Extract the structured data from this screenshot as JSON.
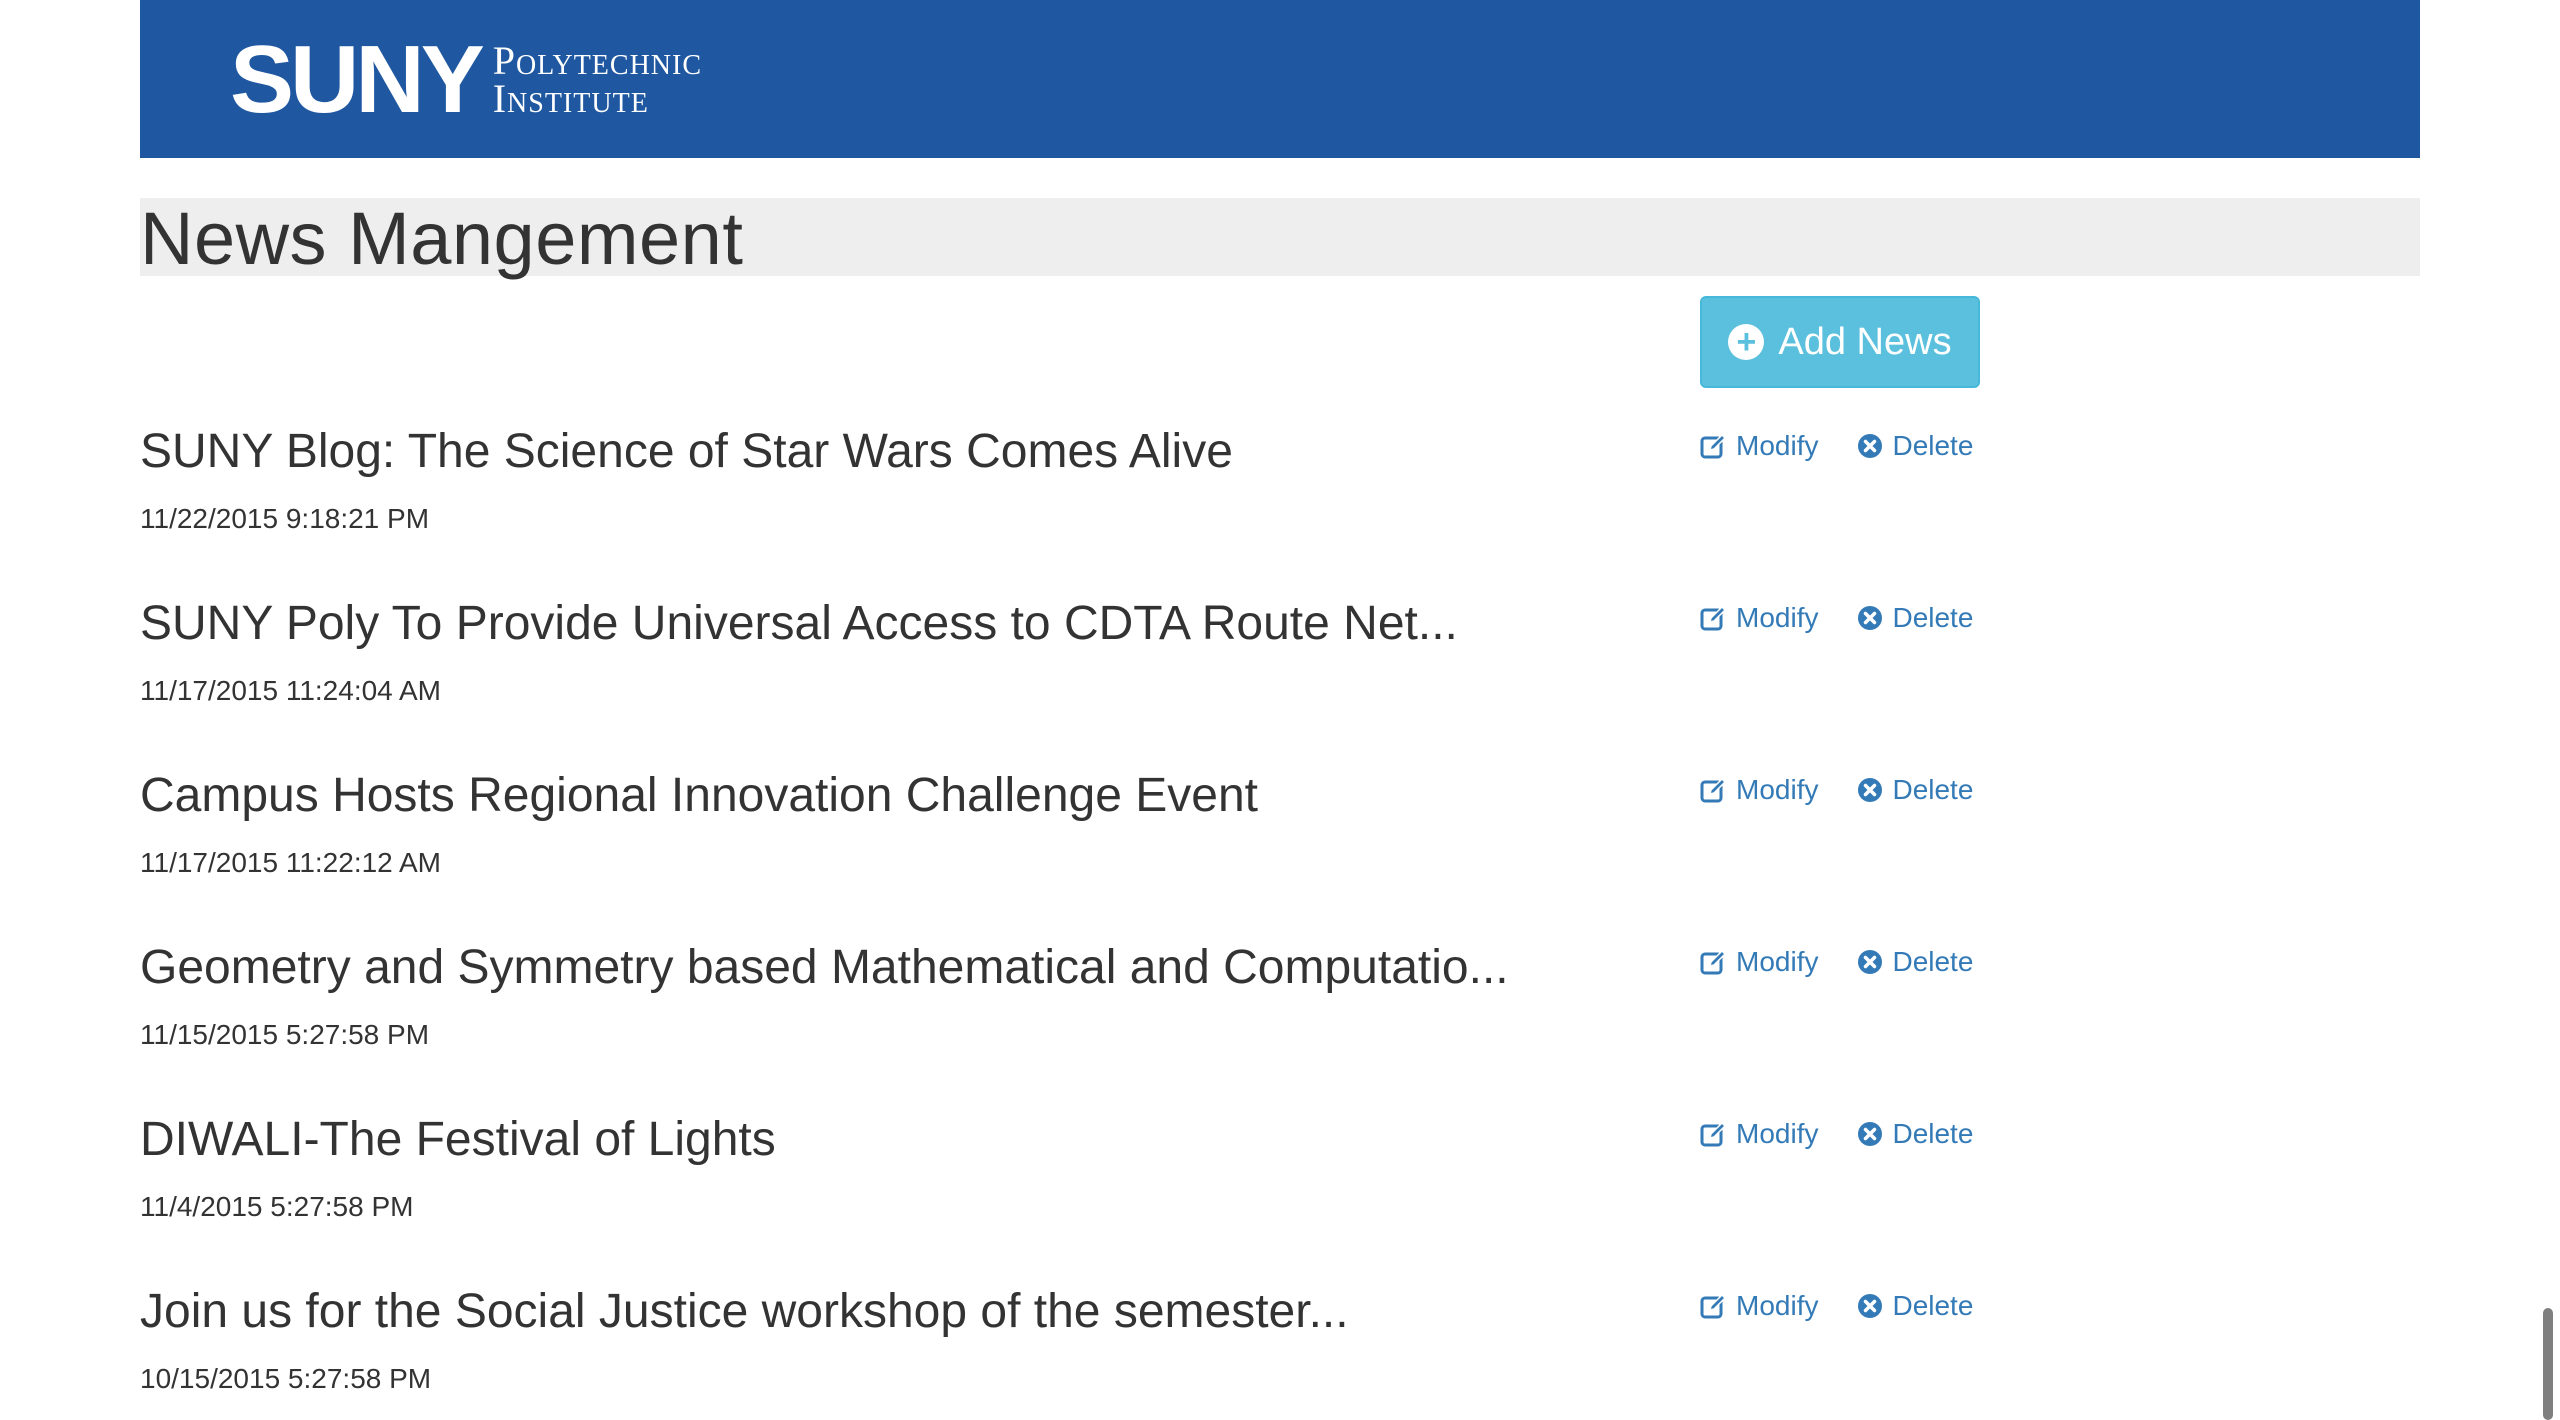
{
  "header": {
    "logo_main": "SUNY",
    "logo_line1": "Polytechnic",
    "logo_line2": "Institute",
    "brand_color": "#1f58a1"
  },
  "page": {
    "title": "News Mangement",
    "add_button_label": "Add News",
    "add_button_icon": "plus-circle-icon"
  },
  "actions": {
    "modify_label": "Modify",
    "modify_icon": "edit-icon",
    "delete_label": "Delete",
    "delete_icon": "times-circle-icon",
    "link_color": "#337ab7"
  },
  "news": [
    {
      "title": "SUNY Blog: The Science of Star Wars Comes Alive",
      "date": "11/22/2015 9:18:21 PM"
    },
    {
      "title": "SUNY Poly To Provide Universal Access to CDTA Route Net...",
      "date": "11/17/2015 11:24:04 AM"
    },
    {
      "title": "Campus Hosts Regional Innovation Challenge Event",
      "date": "11/17/2015 11:22:12 AM"
    },
    {
      "title": "Geometry and Symmetry based Mathematical and Computatio...",
      "date": "11/15/2015 5:27:58 PM"
    },
    {
      "title": "DIWALI-The Festival of Lights",
      "date": "11/4/2015 5:27:58 PM"
    },
    {
      "title": "Join us for the Social Justice workshop of the semester...",
      "date": "10/15/2015 5:27:58 PM"
    }
  ]
}
